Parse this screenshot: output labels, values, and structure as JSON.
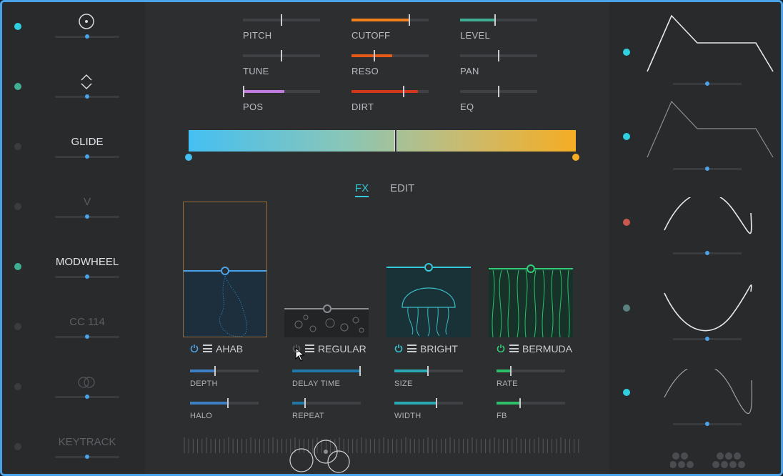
{
  "colors": {
    "accent": "#4aa3e8",
    "cyan": "#35c8d8",
    "orange": "#f07f1c",
    "red": "#d2361b",
    "purple": "#c27adf",
    "teal": "#3fae92",
    "gradient_left": "#45bff2",
    "gradient_right": "#f5ad24"
  },
  "mod_sources": [
    {
      "label": "",
      "icon": "target-icon",
      "dot_color": "#2fd0df",
      "value": 0.5
    },
    {
      "label": "",
      "icon": "up-down-chevron-icon",
      "dot_color": "#3fae92",
      "value": 0.5
    },
    {
      "label": "GLIDE",
      "icon": "",
      "dot_color": "#3b3c3f",
      "value": 0.5
    },
    {
      "label": "V",
      "icon": "",
      "dot_color": "#3b3c3f",
      "value": 0.5
    },
    {
      "label": "MODWHEEL",
      "icon": "",
      "dot_color": "#3fae92",
      "value": 0.5
    },
    {
      "label": "CC 114",
      "icon": "",
      "dot_color": "#3b3c3f",
      "value": 0.5
    },
    {
      "label": "",
      "icon": "rings-icon",
      "dot_color": "#3b3c3f",
      "value": 0.5
    },
    {
      "label": "KEYTRACK",
      "icon": "",
      "dot_color": "#3b3c3f",
      "value": 0.5
    }
  ],
  "params": [
    {
      "name": "PITCH",
      "value": 0.5,
      "fill": 0,
      "color": ""
    },
    {
      "name": "CUTOFF",
      "value": 0.75,
      "fill": 0.75,
      "color": "#f07f1c"
    },
    {
      "name": "LEVEL",
      "value": 0.45,
      "fill": 0.45,
      "color": "#3fae92"
    },
    {
      "name": "TUNE",
      "value": 0.5,
      "fill": 0,
      "color": ""
    },
    {
      "name": "RESO",
      "value": 0.3,
      "fill": 0.53,
      "color": "#e65a18"
    },
    {
      "name": "PAN",
      "value": 0.5,
      "fill": 0,
      "color": ""
    },
    {
      "name": "POS",
      "value": 0.01,
      "fill": 0.54,
      "color": "#c27adf"
    },
    {
      "name": "DIRT",
      "value": 0.68,
      "fill": 0.86,
      "color": "#d2361b"
    },
    {
      "name": "EQ",
      "value": 0.5,
      "fill": 0,
      "color": ""
    }
  ],
  "tabs": [
    {
      "label": "FX",
      "active": true
    },
    {
      "label": "EDIT",
      "active": false
    }
  ],
  "fx": [
    {
      "name": "AHAB",
      "power_color": "#4aa3e8",
      "p1": "DEPTH",
      "p1v": 0.38,
      "p1c": "#3e7fc4",
      "p2": "HALO",
      "p2v": 0.56,
      "p2c": "#3e7fc4"
    },
    {
      "name": "REGULAR",
      "power_color": "#5a5c60",
      "p1": "DELAY TIME",
      "p1v": 1.0,
      "p1c": "#1f79a8",
      "p2": "REPEAT",
      "p2v": 0.2,
      "p2c": "#1f79a8"
    },
    {
      "name": "BRIGHT",
      "power_color": "#35c8d8",
      "p1": "SIZE",
      "p1v": 0.5,
      "p1c": "#2ba9b3",
      "p2": "WIDTH",
      "p2v": 0.63,
      "p2c": "#2ba9b3"
    },
    {
      "name": "BERMUDA",
      "power_color": "#2fcf7a",
      "p1": "RATE",
      "p1v": 0.22,
      "p1c": "#2fbf6a",
      "p2": "FB",
      "p2v": 0.35,
      "p2c": "#2fbf6a"
    }
  ],
  "envelopes": [
    {
      "dot_color": "#2fd0df",
      "shape": "adsr-bright",
      "value": 0.5
    },
    {
      "dot_color": "#2fd0df",
      "shape": "adsr-dim",
      "value": 0.5
    },
    {
      "dot_color": "#c8584f",
      "shape": "sine",
      "value": 0.5
    },
    {
      "dot_color": "#5a8080",
      "shape": "sine-inverted",
      "value": 0.5
    },
    {
      "dot_color": "#2fd0df",
      "shape": "sine-dim",
      "value": 0.5
    }
  ]
}
